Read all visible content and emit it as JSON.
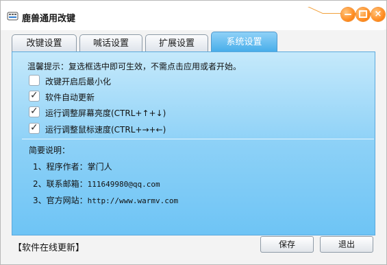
{
  "window": {
    "title": "鹿兽通用改键",
    "icon": "keyboard-icon",
    "accent_color": "#ff8a1d",
    "controls": {
      "minimize": "minimize-icon",
      "maximize": "maximize-icon",
      "close": "×"
    }
  },
  "tabs": [
    {
      "label": "改键设置",
      "active": false
    },
    {
      "label": "喊话设置",
      "active": false
    },
    {
      "label": "扩展设置",
      "active": false
    },
    {
      "label": "系统设置",
      "active": true
    }
  ],
  "panel": {
    "hint": "温馨提示：复选框选中即可生效，不需点击应用或者开始。",
    "options": [
      {
        "label": "改键开启后最小化",
        "checked": false
      },
      {
        "label": "软件自动更新",
        "checked": true
      },
      {
        "label": "运行调整屏幕亮度(CTRL+↑+↓)",
        "checked": true
      },
      {
        "label": "运行调整鼠标速度(CTRL+→+←)",
        "checked": true
      }
    ],
    "description_title": "简要说明：",
    "info": [
      {
        "label": "1、程序作者：",
        "value": "掌门人"
      },
      {
        "label": "2、联系邮箱：",
        "value": "111649980@qq.com"
      },
      {
        "label": "3、官方网站：",
        "value": "http://www.warmv.com"
      }
    ],
    "background_color": "#8dd1f7"
  },
  "footer": {
    "update_link": "【软件在线更新】",
    "save_button": "保存",
    "exit_button": "退出"
  }
}
